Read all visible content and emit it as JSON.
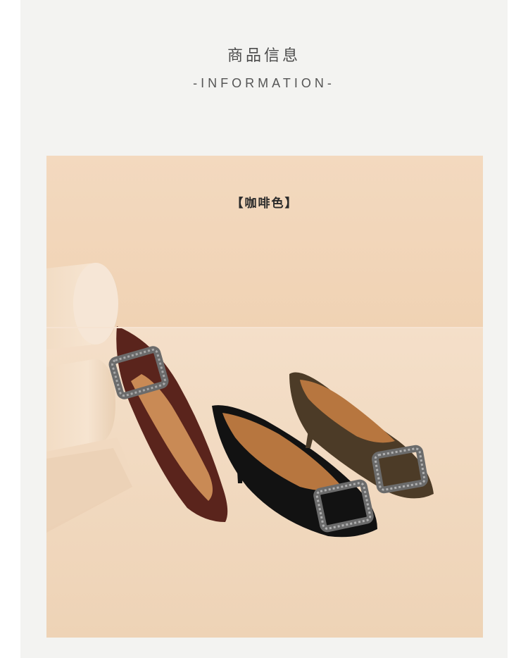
{
  "header": {
    "title": "商品信息",
    "subtitle": "-INFORMATION-"
  },
  "photo": {
    "color_label": "【咖啡色】",
    "background_color": "#f2d6b9",
    "shoes": [
      {
        "color": "#5a241c",
        "buckle": "rhinestone-square"
      },
      {
        "color": "#111111",
        "buckle": "rhinestone-square"
      },
      {
        "color": "#4c3b27",
        "buckle": "rhinestone-square"
      }
    ]
  }
}
